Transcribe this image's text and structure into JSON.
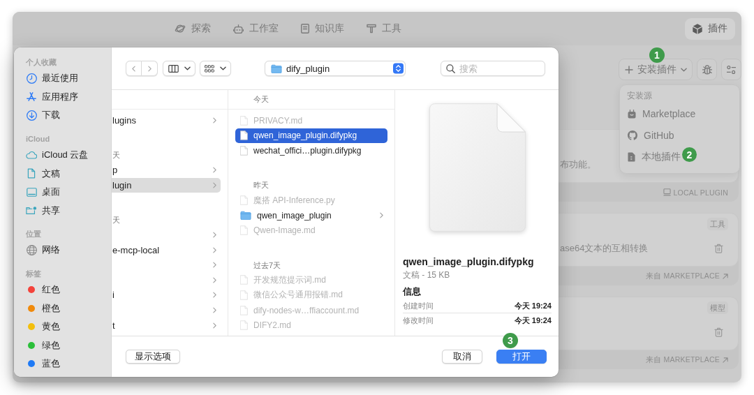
{
  "app": {
    "nav": [
      {
        "kind": "explore",
        "label": "探索",
        "selected": false
      },
      {
        "kind": "studio",
        "label": "工作室",
        "selected": false
      },
      {
        "kind": "knowledge",
        "label": "知识库",
        "selected": false
      },
      {
        "kind": "tools",
        "label": "工具",
        "selected": false
      }
    ],
    "plugins_tab": {
      "label": "插件",
      "selected": true
    }
  },
  "plugin_toolbar": {
    "install_button": {
      "label": "安装插件",
      "step": "1"
    }
  },
  "install_menu": {
    "heading": "安装源",
    "items": [
      {
        "kind": "marketplace",
        "label": "Marketplace"
      },
      {
        "kind": "github",
        "label": "GitHub"
      },
      {
        "kind": "local",
        "label": "本地插件",
        "step": "2"
      }
    ]
  },
  "plugin_cards": [
    {
      "description": "布功能。",
      "source": {
        "kind": "local",
        "label": "LOCAL PLUGIN"
      }
    },
    {
      "tag": "工具",
      "description": "ase64文本的互相转换",
      "delete_icon": true,
      "source": {
        "kind": "marketplace",
        "label": "来自 MARKETPLACE"
      }
    },
    {
      "tag": "模型",
      "delete_icon": true,
      "source": {
        "kind": "marketplace",
        "label": "来自 MARKETPLACE"
      }
    }
  ],
  "file_dialog": {
    "sidebar": [
      {
        "header": "个人收藏",
        "items": [
          {
            "kind": "recents",
            "label": "最近使用",
            "selected": false
          },
          {
            "kind": "applications",
            "label": "应用程序",
            "selected": false
          },
          {
            "kind": "downloads",
            "label": "下载",
            "selected": false
          }
        ]
      },
      {
        "header": "iCloud",
        "items": [
          {
            "kind": "icloud",
            "label": "iCloud 云盘",
            "selected": false
          },
          {
            "kind": "documents",
            "label": "文稿",
            "selected": false
          },
          {
            "kind": "desktop",
            "label": "桌面",
            "selected": false
          },
          {
            "kind": "shared",
            "label": "共享",
            "selected": false
          }
        ]
      },
      {
        "header": "位置",
        "items": [
          {
            "kind": "network",
            "label": "网络",
            "selected": false
          }
        ]
      },
      {
        "header": "标签",
        "items": [
          {
            "kind": "tag",
            "label": "红色",
            "color": "#f4433b",
            "selected": false
          },
          {
            "kind": "tag",
            "label": "橙色",
            "color": "#f08a0c",
            "selected": false
          },
          {
            "kind": "tag",
            "label": "黄色",
            "color": "#f3bf0d",
            "selected": false
          },
          {
            "kind": "tag",
            "label": "绿色",
            "color": "#2bbf3a",
            "selected": false
          },
          {
            "kind": "tag",
            "label": "蓝色",
            "color": "#1f7af5",
            "selected": false
          }
        ]
      }
    ],
    "toolbar": {
      "path": "dify_plugin",
      "search": {
        "placeholder": "搜索"
      }
    },
    "columns": [
      {
        "sections": [
          {
            "items": [
              {
                "kind": "folder",
                "label": "lugins",
                "selected": false
              }
            ]
          },
          {
            "header": "天",
            "items": [
              {
                "kind": "folder",
                "label": "p",
                "selected": false
              },
              {
                "kind": "folder",
                "label": "lugin",
                "selected": true
              }
            ]
          },
          {
            "header": "天",
            "items": [
              {
                "kind": "folder",
                "selected": false
              },
              {
                "kind": "folder",
                "label": "e-mcp-local",
                "selected": false
              },
              {
                "kind": "folder",
                "selected": false
              },
              {
                "kind": "folder",
                "selected": false
              },
              {
                "kind": "folder",
                "label": "i",
                "selected": false
              },
              {
                "kind": "folder",
                "selected": false
              },
              {
                "kind": "folder",
                "label": "t",
                "selected": false
              }
            ]
          }
        ]
      },
      {
        "sections": [
          {
            "header": "今天",
            "items": [
              {
                "kind": "file",
                "label": "PRIVACY.md",
                "selected": false,
                "disabled": true
              },
              {
                "kind": "file",
                "label": "qwen_image_plugin.difypkg",
                "selected": true,
                "disabled": false
              },
              {
                "kind": "file",
                "label": "wechat_offici…plugin.difypkg",
                "selected": false,
                "disabled": false
              }
            ]
          },
          {
            "header": "昨天",
            "items": [
              {
                "kind": "file",
                "label": "魔搭 API-Inference.py",
                "selected": false,
                "disabled": true
              },
              {
                "kind": "folder",
                "label": "qwen_image_plugin",
                "selected": false,
                "disabled": false
              },
              {
                "kind": "file",
                "label": "Qwen-Image.md",
                "selected": false,
                "disabled": true
              }
            ]
          },
          {
            "header": "过去7天",
            "items": [
              {
                "kind": "file",
                "label": "开发规范提示词.md",
                "selected": false,
                "disabled": true
              },
              {
                "kind": "file",
                "label": "微信公众号通用报错.md",
                "selected": false,
                "disabled": true
              },
              {
                "kind": "file",
                "label": "dify-nodes-w…ffiaccount.md",
                "selected": false,
                "disabled": true
              },
              {
                "kind": "file",
                "label": "DIFY2.md",
                "selected": false,
                "disabled": true
              }
            ]
          }
        ]
      }
    ],
    "preview": {
      "name": "qwen_image_plugin.difypkg",
      "summary": "文稿 - 15 KB",
      "info_heading": "信息",
      "info": [
        {
          "label": "创建时间",
          "value": "今天 19:24"
        },
        {
          "label": "修改时间",
          "value": "今天 19:24"
        }
      ]
    },
    "footer": {
      "options_button": "显示选项",
      "cancel_button": "取消",
      "open_button": {
        "label": "打开",
        "step": "3"
      }
    }
  }
}
